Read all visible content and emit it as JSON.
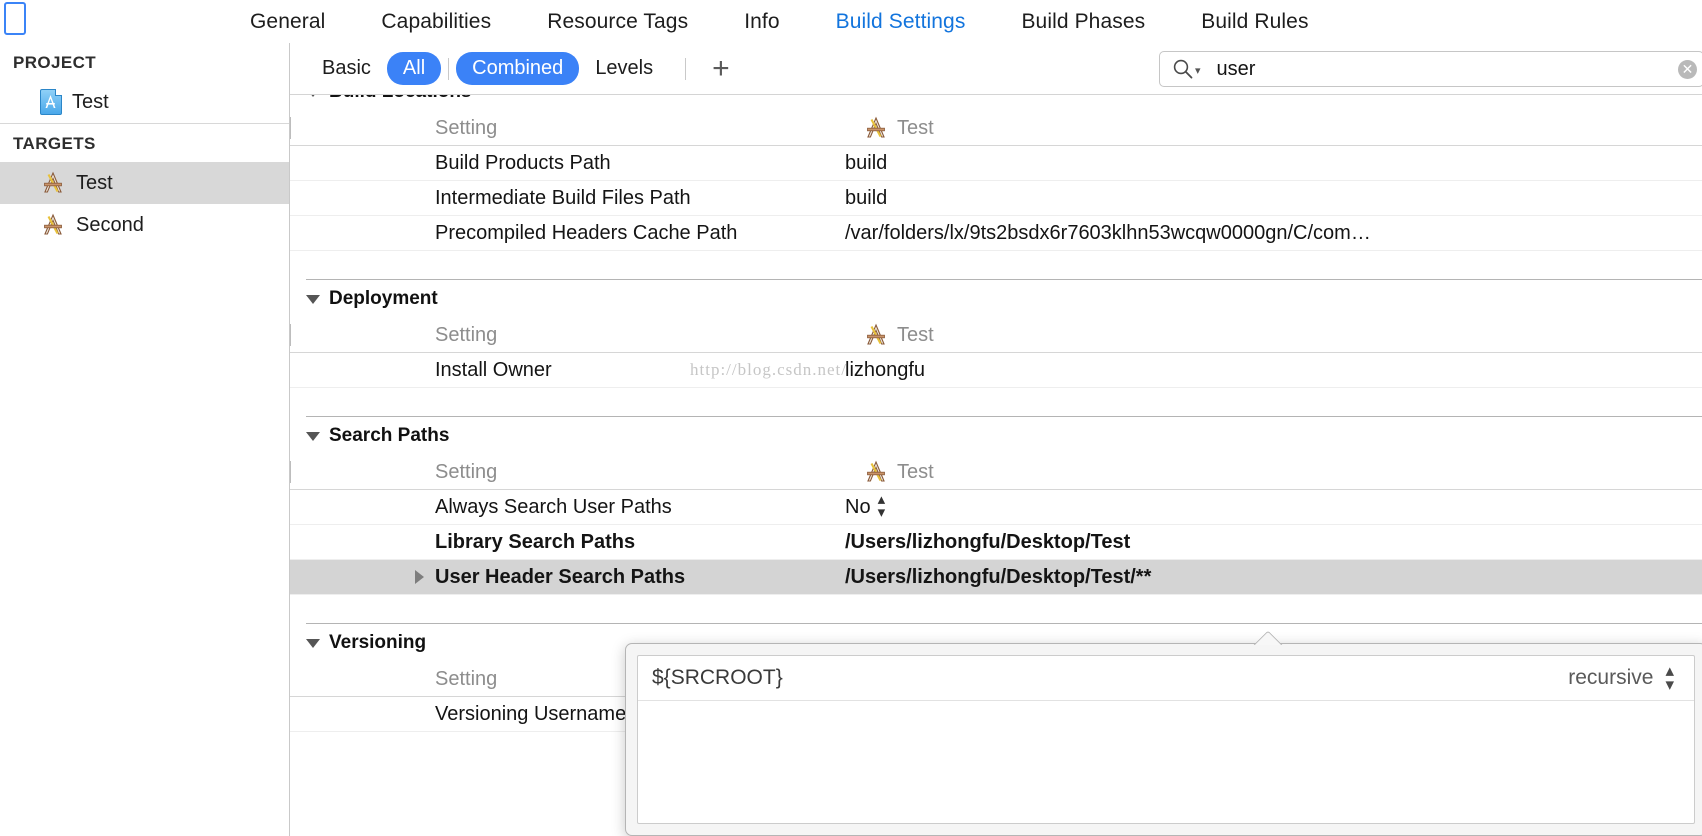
{
  "tabbar": {
    "tabs": [
      {
        "label": "General",
        "selected": false
      },
      {
        "label": "Capabilities",
        "selected": false
      },
      {
        "label": "Resource Tags",
        "selected": false
      },
      {
        "label": "Info",
        "selected": false
      },
      {
        "label": "Build Settings",
        "selected": true
      },
      {
        "label": "Build Phases",
        "selected": false
      },
      {
        "label": "Build Rules",
        "selected": false
      }
    ],
    "accent_color": "#1274dd"
  },
  "sidebar": {
    "project_header": "PROJECT",
    "project_items": [
      {
        "label": "Test",
        "icon": "project-document-icon"
      }
    ],
    "targets_header": "TARGETS",
    "target_items": [
      {
        "label": "Test",
        "icon": "target-icon",
        "selected": true
      },
      {
        "label": "Second",
        "icon": "target-icon",
        "selected": false
      }
    ]
  },
  "filterbar": {
    "basic_label": "Basic",
    "all_label": "All",
    "combined_label": "Combined",
    "levels_label": "Levels",
    "add_label": "+",
    "active_color": "#3b82f7"
  },
  "search": {
    "icon": "search-icon",
    "value": "user",
    "placeholder": "",
    "clear_label": "✕"
  },
  "settings": {
    "column_header_setting": "Setting",
    "column_header_target": "Test",
    "groups": [
      {
        "title": "Build Locations",
        "clipped": true,
        "rows": [
          {
            "name": "Build Products Path",
            "value": "build",
            "bold": false
          },
          {
            "name": "Intermediate Build Files Path",
            "value": "build",
            "bold": false
          },
          {
            "name": "Precompiled Headers Cache Path",
            "value": "/var/folders/lx/9ts2bsdx6r7603klhn53wcqw0000gn/C/com…",
            "bold": false
          }
        ]
      },
      {
        "title": "Deployment",
        "clipped": false,
        "rows": [
          {
            "name": "Install Owner",
            "value": "lizhongfu",
            "bold": false,
            "watermark": "http://blog.csdn.net/"
          }
        ]
      },
      {
        "title": "Search Paths",
        "clipped": false,
        "rows": [
          {
            "name": "Always Search User Paths",
            "value": "No",
            "bold": false,
            "stepper": true
          },
          {
            "name": "Library Search Paths",
            "value": "/Users/lizhongfu/Desktop/Test",
            "bold": true
          },
          {
            "name": "User Header Search Paths",
            "value": "/Users/lizhongfu/Desktop/Test/**",
            "bold": true,
            "selected": true,
            "expand_arrow": true
          }
        ]
      },
      {
        "title": "Versioning",
        "clipped": false,
        "rows": [
          {
            "name": "Versioning Username",
            "value": "",
            "bold": false
          }
        ]
      }
    ]
  },
  "popover": {
    "rows": [
      {
        "path": "${SRCROOT}",
        "mode": "recursive"
      }
    ]
  }
}
